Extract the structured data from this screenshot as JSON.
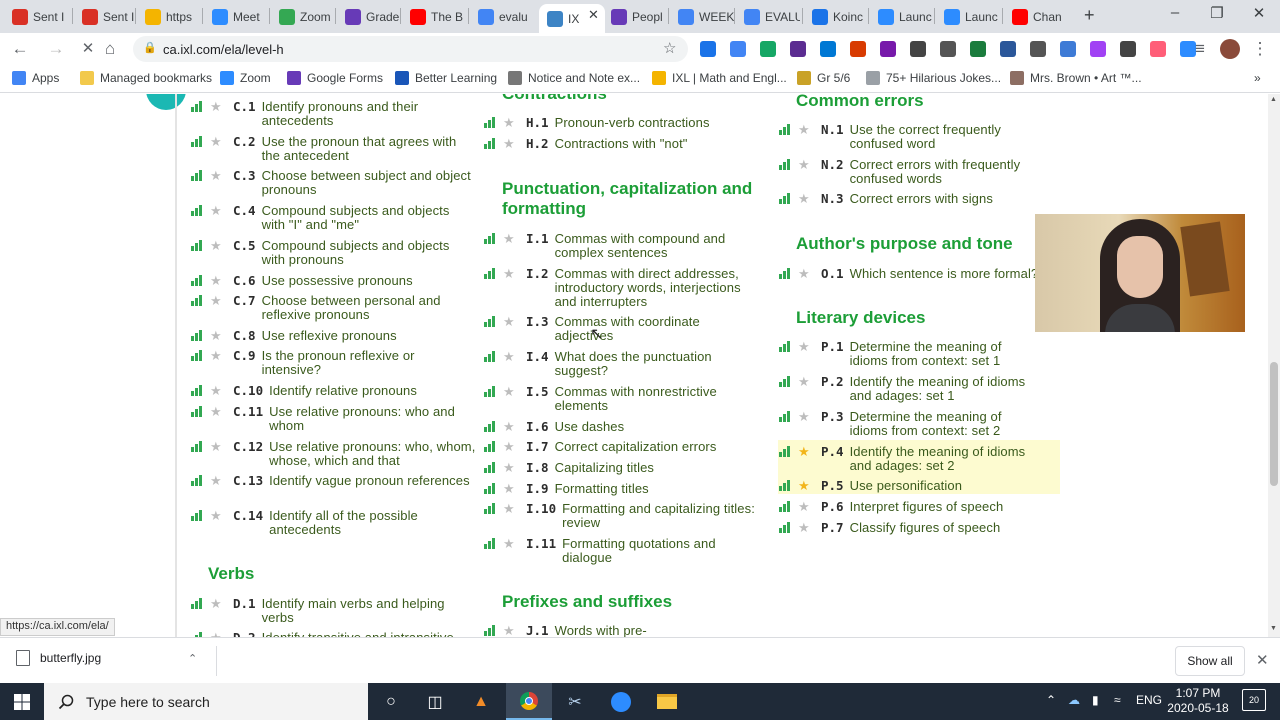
{
  "tabs": [
    {
      "label": "Sent I",
      "icon": "gmail-icon",
      "color": "#d93025"
    },
    {
      "label": "Sent I",
      "icon": "gmail-icon",
      "color": "#d93025"
    },
    {
      "label": "https",
      "icon": "slides-icon",
      "color": "#f4b400"
    },
    {
      "label": "Meet",
      "icon": "zoom-icon",
      "color": "#2d8cff"
    },
    {
      "label": "Zoom",
      "icon": "drive-icon",
      "color": "#34a853"
    },
    {
      "label": "Grade",
      "icon": "forms-icon",
      "color": "#673ab7"
    },
    {
      "label": "The B",
      "icon": "youtube-icon",
      "color": "#ff0000"
    },
    {
      "label": "evalu",
      "icon": "google-icon",
      "color": "#4285f4"
    },
    {
      "label": "IX",
      "icon": "ixl-icon",
      "color": "#3d84c5"
    },
    {
      "label": "Peopl",
      "icon": "forms-icon",
      "color": "#673ab7"
    },
    {
      "label": "WEEK",
      "icon": "docs-icon",
      "color": "#4285f4"
    },
    {
      "label": "EVALU",
      "icon": "docs-icon",
      "color": "#4285f4"
    },
    {
      "label": "Koinc",
      "icon": "calendar-icon",
      "color": "#1a73e8"
    },
    {
      "label": "Launc",
      "icon": "zoom-icon",
      "color": "#2d8cff"
    },
    {
      "label": "Launc",
      "icon": "zoom-icon",
      "color": "#2d8cff"
    },
    {
      "label": "Chan",
      "icon": "youtube-icon",
      "color": "#ff0000"
    }
  ],
  "address": {
    "url": "ca.ixl.com/ela/level-h"
  },
  "bookmarks": [
    {
      "label": "Apps",
      "color": "#4285f4"
    },
    {
      "label": "Managed bookmarks",
      "color": "#f2c94c"
    },
    {
      "label": "Zoom",
      "color": "#2d8cff"
    },
    {
      "label": "Google Forms",
      "color": "#673ab7"
    },
    {
      "label": "Better Learning",
      "color": "#1a56b8"
    },
    {
      "label": "Notice and Note ex...",
      "color": "#777777"
    },
    {
      "label": "IXL | Math and Engl...",
      "color": "#f4b400"
    },
    {
      "label": "Gr 5/6",
      "color": "#c9a227"
    },
    {
      "label": "75+ Hilarious Jokes...",
      "color": "#9aa0a6"
    },
    {
      "label": "Mrs. Brown • Art ™...",
      "color": "#8d6e63"
    }
  ],
  "colors": {
    "section_green": "#1c9e37",
    "bar_green": "#32a852",
    "star_gold": "#f2b51b",
    "highlight": "#fdfbd0"
  },
  "sections": {
    "contractions": "Contractions",
    "punctuation": "Punctuation, capitalization and formatting",
    "prefixes": "Prefixes and suffixes",
    "verbs": "Verbs",
    "common_errors": "Common errors",
    "purpose": "Author's purpose and tone",
    "literary": "Literary devices"
  },
  "col1": [
    {
      "code": "C.1",
      "name": "Identify pronouns and their antecedents"
    },
    {
      "code": "C.2",
      "name": "Use the pronoun that agrees with the antecedent"
    },
    {
      "code": "C.3",
      "name": "Choose between subject and object pronouns"
    },
    {
      "code": "C.4",
      "name": "Compound subjects and objects with \"I\" and \"me\""
    },
    {
      "code": "C.5",
      "name": "Compound subjects and objects with pronouns"
    },
    {
      "code": "C.6",
      "name": "Use possessive pronouns"
    },
    {
      "code": "C.7",
      "name": "Choose between personal and reflexive pronouns"
    },
    {
      "code": "C.8",
      "name": "Use reflexive pronouns"
    },
    {
      "code": "C.9",
      "name": "Is the pronoun reflexive or intensive?"
    },
    {
      "code": "C.10",
      "name": "Identify relative pronouns"
    },
    {
      "code": "C.11",
      "name": "Use relative pronouns: who and whom"
    },
    {
      "code": "C.12",
      "name": "Use relative pronouns: who, whom, whose, which and that"
    },
    {
      "code": "C.13",
      "name": "Identify vague pronoun references"
    },
    {
      "code": "C.14",
      "name": "Identify all of the possible antecedents"
    },
    {
      "code": "D.1",
      "name": "Identify main verbs and helping verbs"
    },
    {
      "code": "D.2",
      "name": "Identify transitive and intransitive"
    }
  ],
  "col2": [
    {
      "code": "H.1",
      "name": "Pronoun-verb contractions"
    },
    {
      "code": "H.2",
      "name": "Contractions with \"not\""
    },
    {
      "code": "I.1",
      "name": "Commas with compound and complex sentences"
    },
    {
      "code": "I.2",
      "name": "Commas with direct addresses, introductory words, interjections and interrupters"
    },
    {
      "code": "I.3",
      "name": "Commas with coordinate adjectives"
    },
    {
      "code": "I.4",
      "name": "What does the punctuation suggest?"
    },
    {
      "code": "I.5",
      "name": "Commas with nonrestrictive elements"
    },
    {
      "code": "I.6",
      "name": "Use dashes"
    },
    {
      "code": "I.7",
      "name": "Correct capitalization errors"
    },
    {
      "code": "I.8",
      "name": "Capitalizing titles"
    },
    {
      "code": "I.9",
      "name": "Formatting titles"
    },
    {
      "code": "I.10",
      "name": "Formatting and capitalizing titles: review"
    },
    {
      "code": "I.11",
      "name": "Formatting quotations and dialogue"
    },
    {
      "code": "J.1",
      "name": "Words with pre-"
    }
  ],
  "col3": [
    {
      "code": "N.1",
      "name": "Use the correct frequently confused word"
    },
    {
      "code": "N.2",
      "name": "Correct errors with frequently confused words"
    },
    {
      "code": "N.3",
      "name": "Correct errors with signs"
    },
    {
      "code": "O.1",
      "name": "Which sentence is more formal?"
    },
    {
      "code": "P.1",
      "name": "Determine the meaning of idioms from context: set 1"
    },
    {
      "code": "P.2",
      "name": "Identify the meaning of idioms and adages: set 1"
    },
    {
      "code": "P.3",
      "name": "Determine the meaning of idioms from context: set 2"
    },
    {
      "code": "P.4",
      "name": "Identify the meaning of idioms and adages: set 2"
    },
    {
      "code": "P.5",
      "name": "Use personification"
    },
    {
      "code": "P.6",
      "name": "Interpret figures of speech"
    },
    {
      "code": "P.7",
      "name": "Classify figures of speech"
    }
  ],
  "status_url": "https://ca.ixl.com/ela/",
  "download": {
    "file": "butterfly.jpg",
    "show_all": "Show all"
  },
  "taskbar": {
    "search_placeholder": "Type here to search",
    "time": "1:07 PM",
    "date": "2020-05-18",
    "lang": "ENG",
    "notif_count": "20"
  }
}
